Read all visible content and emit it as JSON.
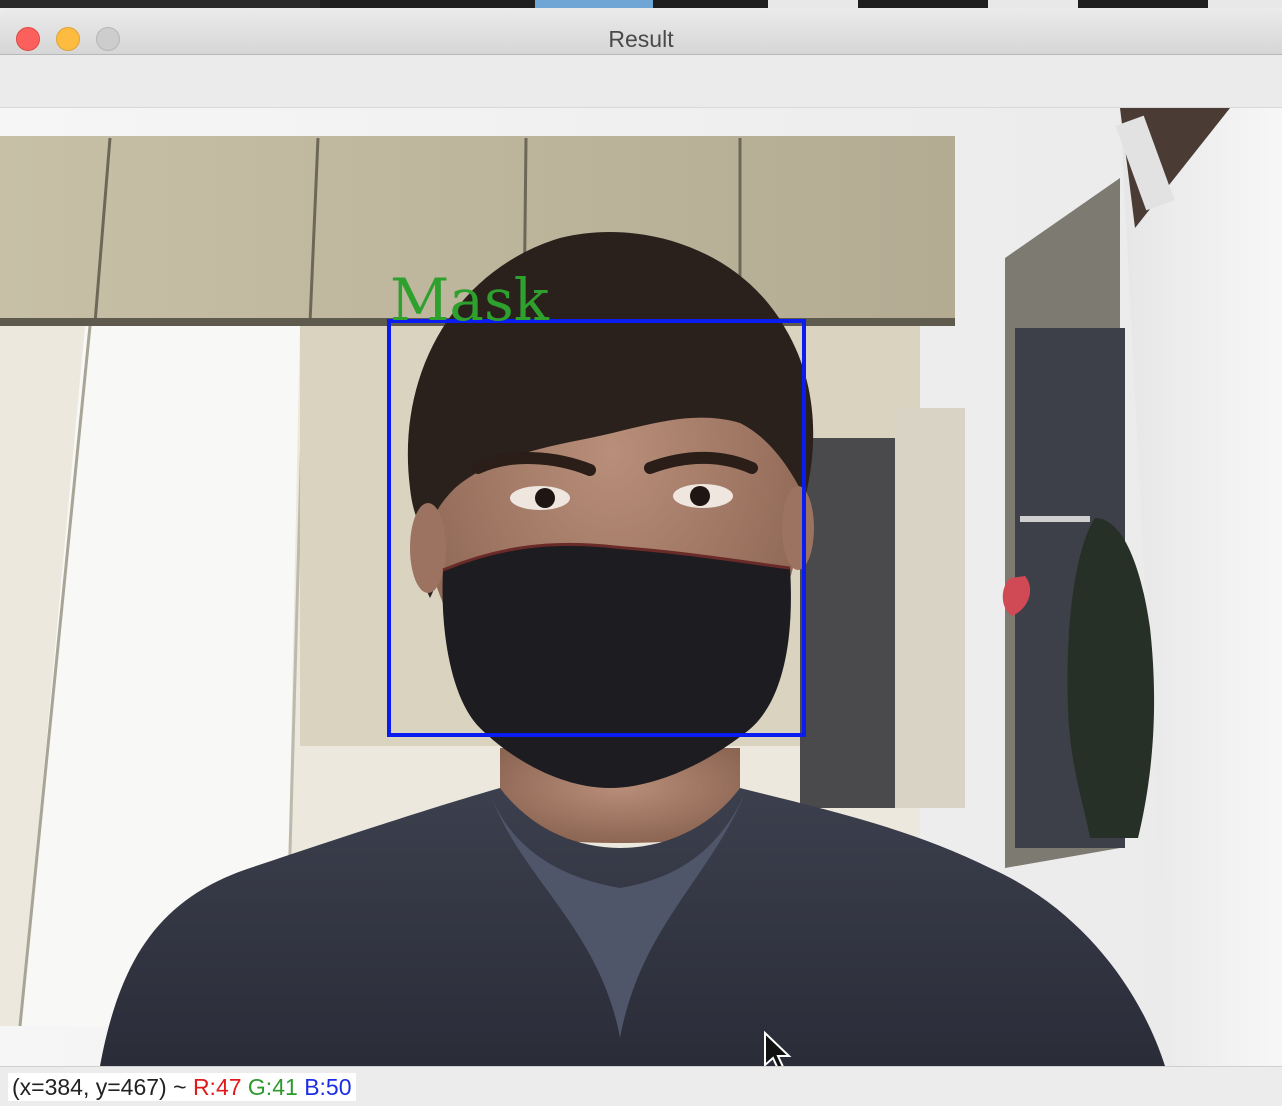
{
  "window": {
    "title": "Result"
  },
  "overlay": {
    "label": "Mask",
    "label_color": "#2ea02e",
    "box_color": "#0a1cf0"
  },
  "status": {
    "coords": "(x=384, y=467) ~ ",
    "r": "R:47",
    "g": "G:41",
    "b": "B:50",
    "r_color": "#e01b1b",
    "g_color": "#2e9a2e",
    "b_color": "#1a2ee6"
  },
  "icons": {
    "close": "close-icon",
    "minimize": "minimize-icon",
    "zoom": "zoom-icon",
    "cursor": "mouse-pointer-icon"
  }
}
